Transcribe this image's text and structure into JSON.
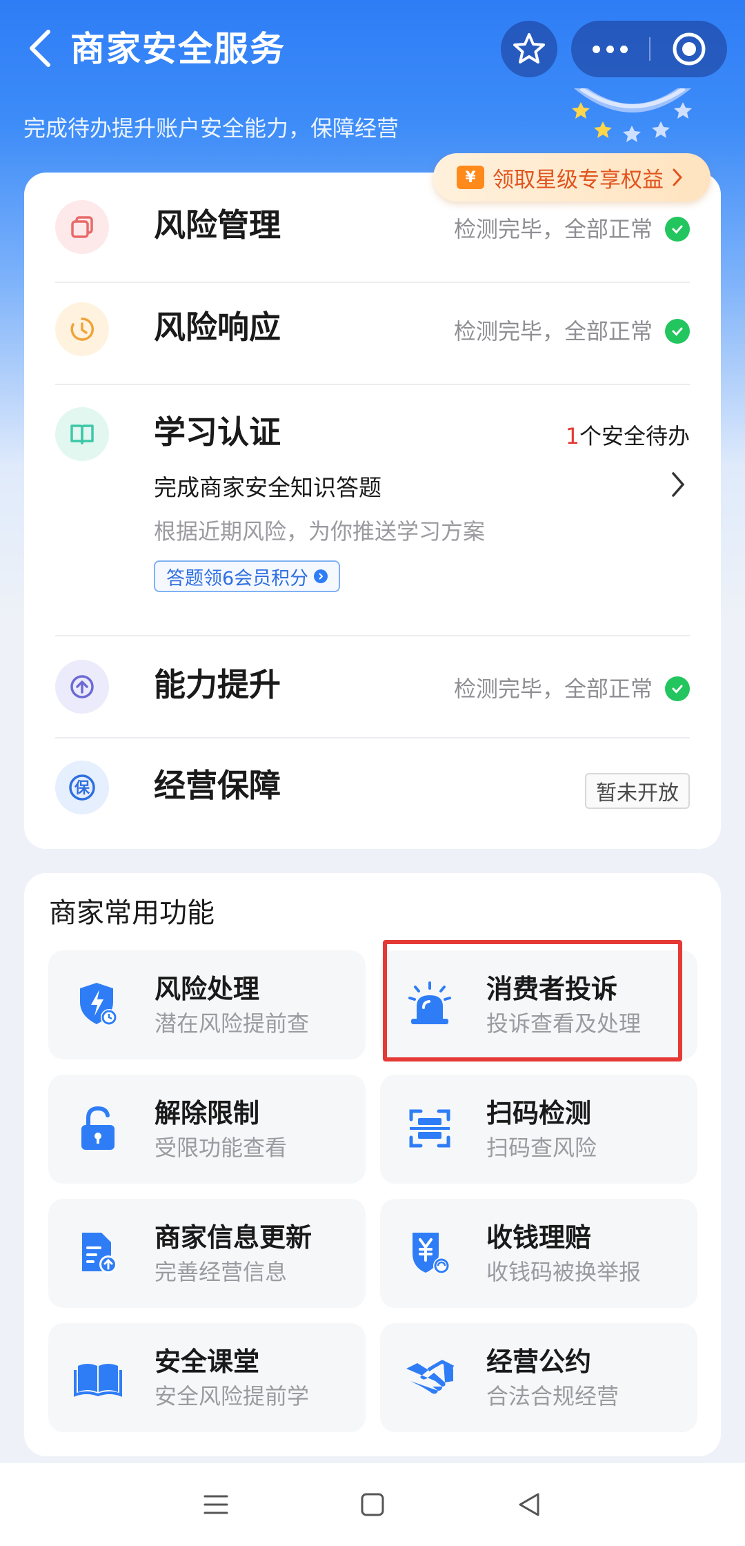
{
  "header": {
    "title": "商家安全服务",
    "subtitle": "完成待办提升账户安全能力，保障经营"
  },
  "rights_button": {
    "icon_text": "¥",
    "label": "领取星级专享权益"
  },
  "security_items": [
    {
      "title": "风险管理",
      "status": "检测完毕，全部正常",
      "icon": "risk-management-icon"
    },
    {
      "title": "风险响应",
      "status": "检测完毕，全部正常",
      "icon": "risk-response-icon"
    },
    {
      "title": "学习认证",
      "icon": "learning-icon"
    },
    {
      "title": "能力提升",
      "status": "检测完毕，全部正常",
      "icon": "ability-icon"
    },
    {
      "title": "经营保障",
      "status": "暂未开放",
      "icon": "protection-icon"
    }
  ],
  "learning": {
    "pending_count": "1",
    "pending_label": "个安全待办",
    "task_title": "完成商家安全知识答题",
    "task_desc": "根据近期风险，为你推送学习方案",
    "points_tag": "答题领6会员积分"
  },
  "functions": {
    "section_title": "商家常用功能",
    "tiles": [
      {
        "name": "风险处理",
        "desc": "潜在风险提前查",
        "icon": "shield-bolt-icon"
      },
      {
        "name": "消费者投诉",
        "desc": "投诉查看及处理",
        "icon": "alarm-light-icon"
      },
      {
        "name": "解除限制",
        "desc": "受限功能查看",
        "icon": "unlock-icon"
      },
      {
        "name": "扫码检测",
        "desc": "扫码查风险",
        "icon": "scan-icon"
      },
      {
        "name": "商家信息更新",
        "desc": "完善经营信息",
        "icon": "document-upload-icon"
      },
      {
        "name": "收钱理赔",
        "desc": "收钱码被换举报",
        "icon": "yen-claim-icon"
      },
      {
        "name": "安全课堂",
        "desc": "安全风险提前学",
        "icon": "book-icon"
      },
      {
        "name": "经营公约",
        "desc": "合法合规经营",
        "icon": "handshake-icon"
      }
    ]
  },
  "colors": {
    "brand_blue": "#2f7df6",
    "ok_green": "#22c55e",
    "alert_red": "#e53935",
    "rights_orange": "#e0541e"
  }
}
